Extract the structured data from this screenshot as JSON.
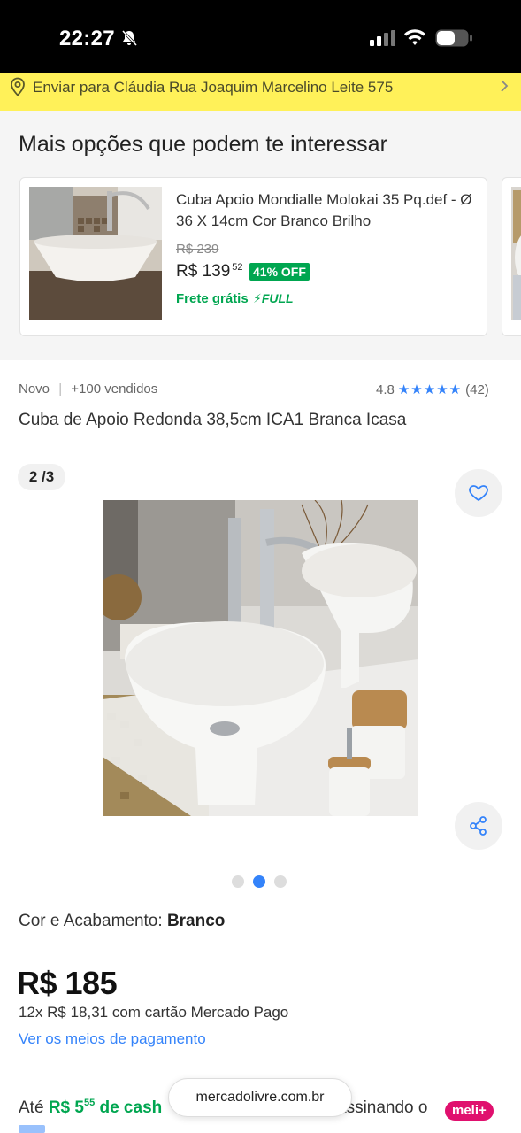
{
  "status_bar": {
    "time": "22:27",
    "icons": [
      "bell-muted-icon",
      "signal-icon",
      "wifi-icon",
      "battery-icon"
    ]
  },
  "address_bar": {
    "text": "Enviar para Cláudia Rua Joaquim Marcelino Leite 575",
    "icon": "location-pin-icon"
  },
  "recommendations": {
    "title": "Mais opções que podem te interessar",
    "items": [
      {
        "name": "Cuba Apoio Mondialle Molokai 35 Pq.def - Ø 36 X 14cm Cor Branco Brilho",
        "old_price": "R$ 239",
        "price": "R$ 139",
        "price_cents": "52",
        "discount": "41% OFF",
        "shipping": "Frete grátis",
        "badge": "FULL"
      }
    ]
  },
  "product": {
    "condition": "Novo",
    "sold": "+100 vendidos",
    "rating_value": "4.8",
    "stars": "★★★★★",
    "rating_count": "(42)",
    "title": "Cuba de Apoio Redonda 38,5cm ICA1 Branca Icasa",
    "image_counter": "2 /3",
    "current_image_index": 2,
    "total_images": 3,
    "color_label": "Cor e Acabamento: ",
    "color_value": "Branco",
    "price": "R$ 185",
    "installments": "12x R$ 18,31 com cartão Mercado Pago",
    "payment_link": "Ver os meios de pagamento",
    "cashback_prefix": "Até ",
    "cashback_value": "R$ 5",
    "cashback_cents": "55",
    "cashback_label": " de cash",
    "cashback_tail": "assinando o",
    "meli_badge": "meli+"
  },
  "browser": {
    "url": "mercadolivre.com.br"
  },
  "colors": {
    "brand_yellow": "#fff159",
    "accent_blue": "#3483fa",
    "discount_green": "#00a650",
    "meli_pink": "#e0106e"
  }
}
